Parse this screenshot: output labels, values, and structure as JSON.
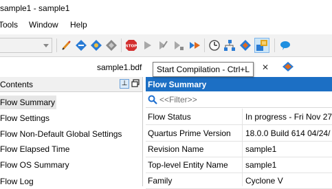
{
  "window": {
    "title": "sample1 - sample1"
  },
  "menubar": [
    {
      "label": "Tools",
      "mnemonic": "T"
    },
    {
      "label": "Window",
      "mnemonic": "W"
    },
    {
      "label": "Help",
      "mnemonic": "H"
    }
  ],
  "toolbar": {
    "icons": [
      "pencil-icon",
      "diamond-blue-icon",
      "diamond-settings-icon",
      "diamond-gray-icon",
      "stop-icon",
      "play-icon",
      "run-analysis-icon",
      "run-fitter-icon",
      "assembler-icon",
      "timing-icon",
      "netlist-icon",
      "programmer-icon",
      "compile-icon",
      "chat-icon"
    ],
    "stop_text": "STOP"
  },
  "tab": {
    "filename": "sample1.bdf",
    "close": "✕"
  },
  "tooltip": {
    "text": "Start Compilation - Ctrl+L"
  },
  "contents": {
    "title": "Contents",
    "pin_glyph": "⊥",
    "items": [
      "Flow Summary",
      "Flow Settings",
      "Flow Non-Default Global Settings",
      "Flow Elapsed Time",
      "Flow OS Summary",
      "Flow Log"
    ],
    "selected_index": 0
  },
  "summary": {
    "title": "Flow Summary",
    "filter_placeholder": "<<Filter>>",
    "rows": [
      {
        "key": "Flow Status",
        "value": "In progress - Fri Nov 27"
      },
      {
        "key": "Quartus Prime Version",
        "value": "18.0.0 Build 614 04/24/"
      },
      {
        "key": "Revision Name",
        "value": "sample1"
      },
      {
        "key": "Top-level Entity Name",
        "value": "sample1"
      },
      {
        "key": "Family",
        "value": "Cyclone V"
      }
    ]
  },
  "colors": {
    "header_blue": "#1c6fc4",
    "toolbar_bg": "#f2f2f2",
    "selected_bg": "#e6e6e6",
    "active_button": "#cde6f7"
  }
}
